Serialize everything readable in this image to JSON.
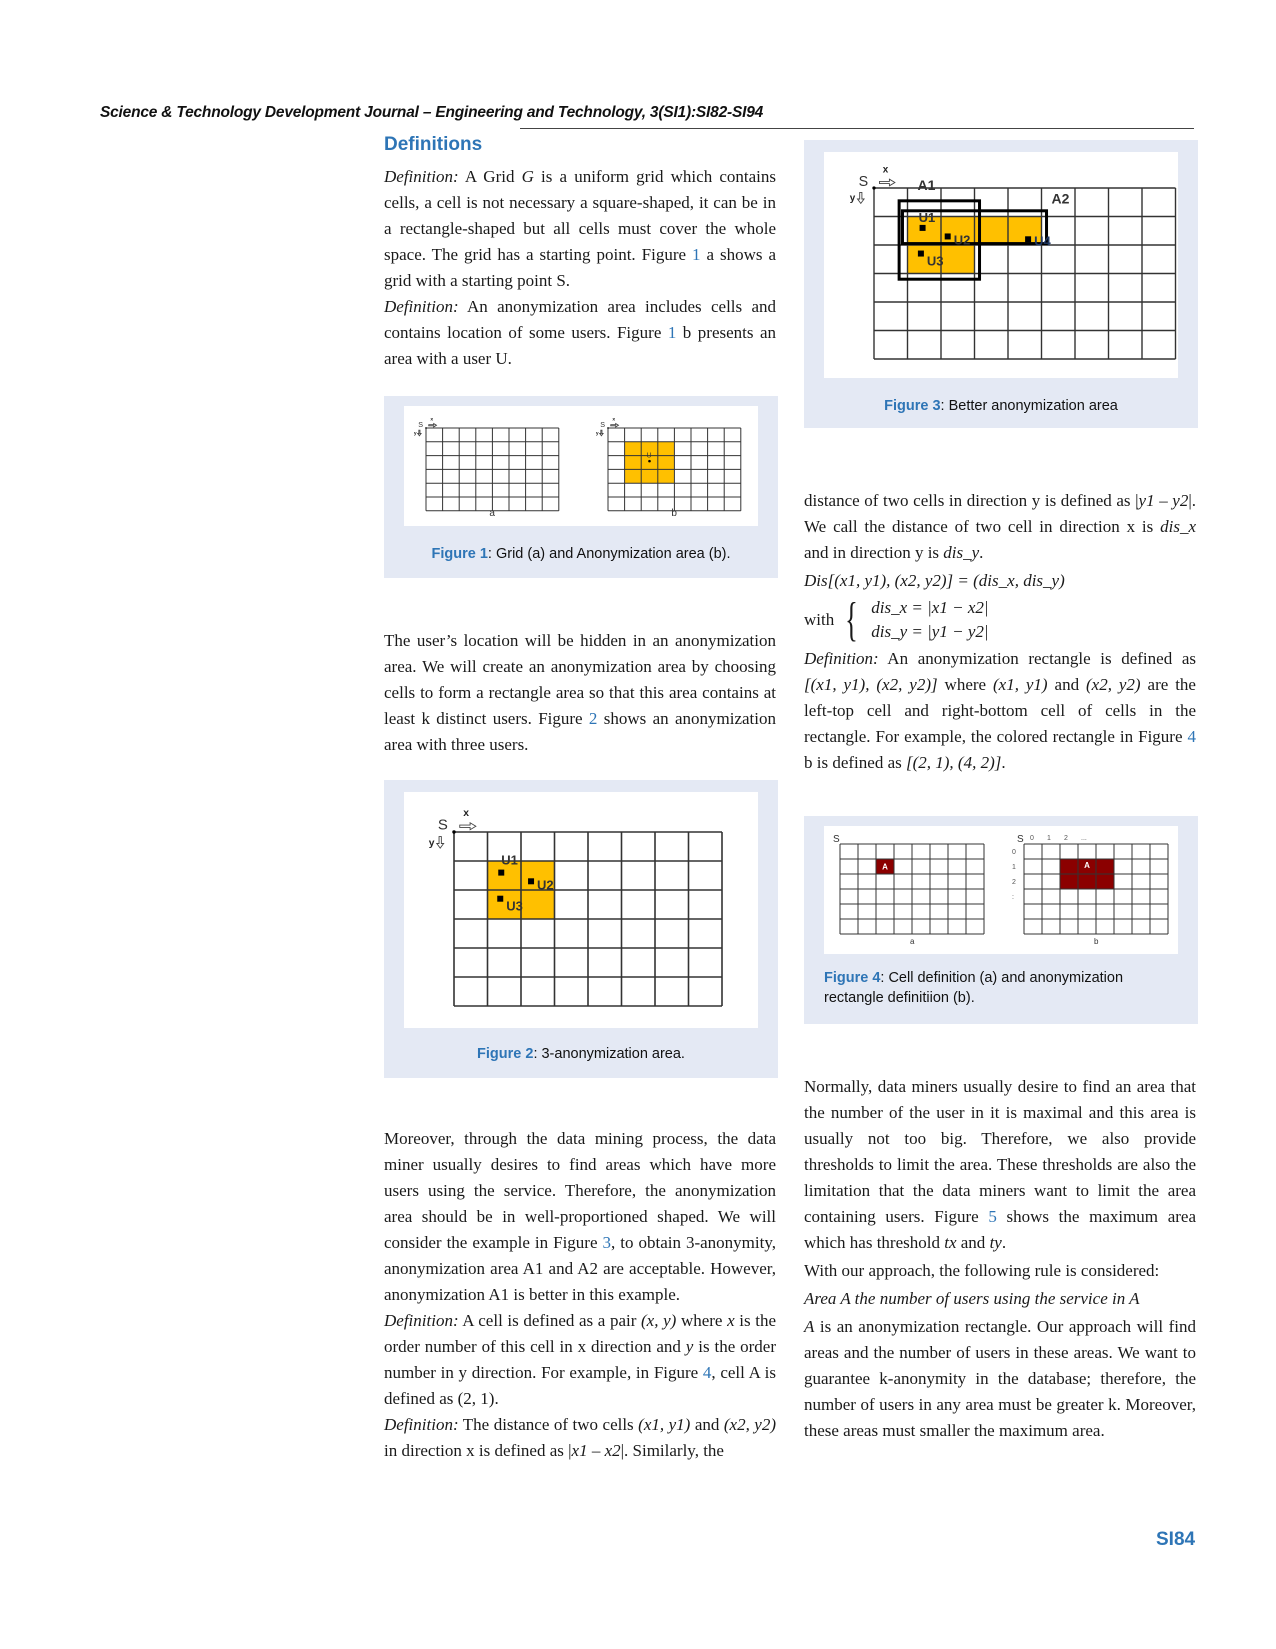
{
  "header": {
    "running_head": "Science & Technology Development Journal – Engineering and Technology, 3(SI1):SI82-SI94"
  },
  "section": {
    "title": "Definitions"
  },
  "left_column": {
    "def1": {
      "label": "Definition:",
      "text_a": " A Grid ",
      "g": "G",
      "text_b": " is a uniform grid which contains cells, a cell is not necessary a square-shaped, it can be in a rectangle-shaped but all cells must cover the whole space. The grid has a starting point. Figure ",
      "ref": "1",
      "text_c": " a shows a grid with a starting point S."
    },
    "def2": {
      "label": "Definition:",
      "text_a": " An anonymization area includes cells and contains location of some users. Figure ",
      "ref": "1",
      "text_b": " b presents an area with a user U."
    },
    "para_hidden": {
      "text_a": "The user’s location will be hidden in an anonymization area. We will create an anonymization area by choosing cells to form a rectangle area so that this area contains at least k distinct users. Figure ",
      "ref": "2",
      "text_b": " shows an anonymization area with three users."
    },
    "para_moreover": {
      "text_a": "Moreover, through the data mining process, the data miner usually desires to find areas which have more users using the service. Therefore, the anonymization area should be in well-proportioned shaped. We will consider the example in Figure ",
      "ref": "3",
      "text_b": ", to obtain 3-anonymity, anonymization area A1 and A2 are acceptable. However, anonymization A1 is better in this example."
    },
    "def3": {
      "label": "Definition:",
      "text_a": " A cell is defined as a pair ",
      "pair": "(x, y)",
      "text_b": " where ",
      "x": "x",
      "text_c": " is the order number of this cell in x direction and ",
      "y": "y",
      "text_d": " is the order number in y direction. For example, in Figure ",
      "ref": "4",
      "text_e": ", cell A is defined as (2, 1)."
    },
    "def4": {
      "label": "Definition:",
      "text_a": " The distance of two cells ",
      "c1": "(x1, y1)",
      "text_b": " and ",
      "c2": "(x2, y2)",
      "text_c": " in direction x is defined as |",
      "expr": "x1 – x2",
      "text_d": "|. Similarly, the"
    }
  },
  "right_column": {
    "cont": {
      "text_a": "distance of two cells in direction y is defined as |",
      "expr": "y1 – y2",
      "text_b": "|. We call the distance of two cell in direction x is ",
      "dx": "dis_x",
      "text_c": " and in direction y is ",
      "dy": "dis_y",
      "text_d": "."
    },
    "formula": "Dis[(x1, y1), (x2, y2)] = (dis_x, dis_y)",
    "with_label": "with",
    "eq1": "dis_x = |x1 − x2|",
    "eq2": "dis_y = |y1 − y2|",
    "def5": {
      "label": "Definition:",
      "text_a": " An anonymization rectangle is defined as ",
      "rect": "[(x1, y1), (x2, y2)]",
      "text_b": " where ",
      "c1": "(x1, y1)",
      "text_c": " and ",
      "c2": "(x2, y2)",
      "text_d": " are the left-top cell and right-bottom cell of cells in the rectangle. For example, the colored rectangle in Figure ",
      "ref": "4",
      "text_e": " b is defined as ",
      "example": "[(2, 1), (4, 2)]",
      "text_f": "."
    },
    "para_normally": {
      "text_a": "Normally, data miners usually desire to find an area that the number of the user in it is maximal and this area is usually not too big. Therefore, we also provide thresholds to limit the area. These thresholds are also the limitation that the data miners want to limit the area containing users. Figure ",
      "ref": "5",
      "text_b": " shows the maximum area which has threshold ",
      "tx": "tx",
      "text_c": " and ",
      "ty": "ty",
      "text_d": "."
    },
    "para_rule": "With our approach, the following rule is considered:",
    "rule": "Area A the number of users using the service in A",
    "para_final": {
      "a": "A",
      "text": " is an anonymization rectangle. Our approach will find areas and the number of users in these areas. We want to guarantee k-anonymity in the database; therefore, the number of users in any area must be greater k. Moreover, these areas must smaller the maximum area."
    }
  },
  "figures": {
    "fig1": {
      "label": "Figure 1",
      "caption": ": Grid (a) and Anonymization area (b).",
      "sub_a": "a",
      "sub_b": "b",
      "s": "S",
      "x": "x",
      "y": "y",
      "user": "U",
      "highlight_color": "#ffc000"
    },
    "fig2": {
      "label": "Figure 2",
      "caption": ": 3-anonymization area.",
      "s": "S",
      "x": "x",
      "y": "y",
      "users": [
        "U1",
        "U2",
        "U3"
      ],
      "highlight_color": "#ffc000"
    },
    "fig3": {
      "label": "Figure 3",
      "caption": ": Better anonymization area",
      "s": "S",
      "x": "x",
      "y": "y",
      "areas": [
        "A1",
        "A2"
      ],
      "users": [
        "U1",
        "U2",
        "U3",
        "U4"
      ],
      "highlight_color": "#ffc000"
    },
    "fig4": {
      "label": "Figure 4",
      "caption": ": Cell definition (a) and anonymization rectangle definitiion (b).",
      "sub_a": "a",
      "sub_b": "b",
      "s": "S",
      "cell": "A",
      "col_ticks": [
        "0",
        "1",
        "2",
        "..."
      ],
      "row_ticks": [
        "0",
        "1",
        "2",
        ":"
      ],
      "highlight_color": "#8b0000"
    }
  },
  "footer": {
    "page_number": "SI84"
  }
}
